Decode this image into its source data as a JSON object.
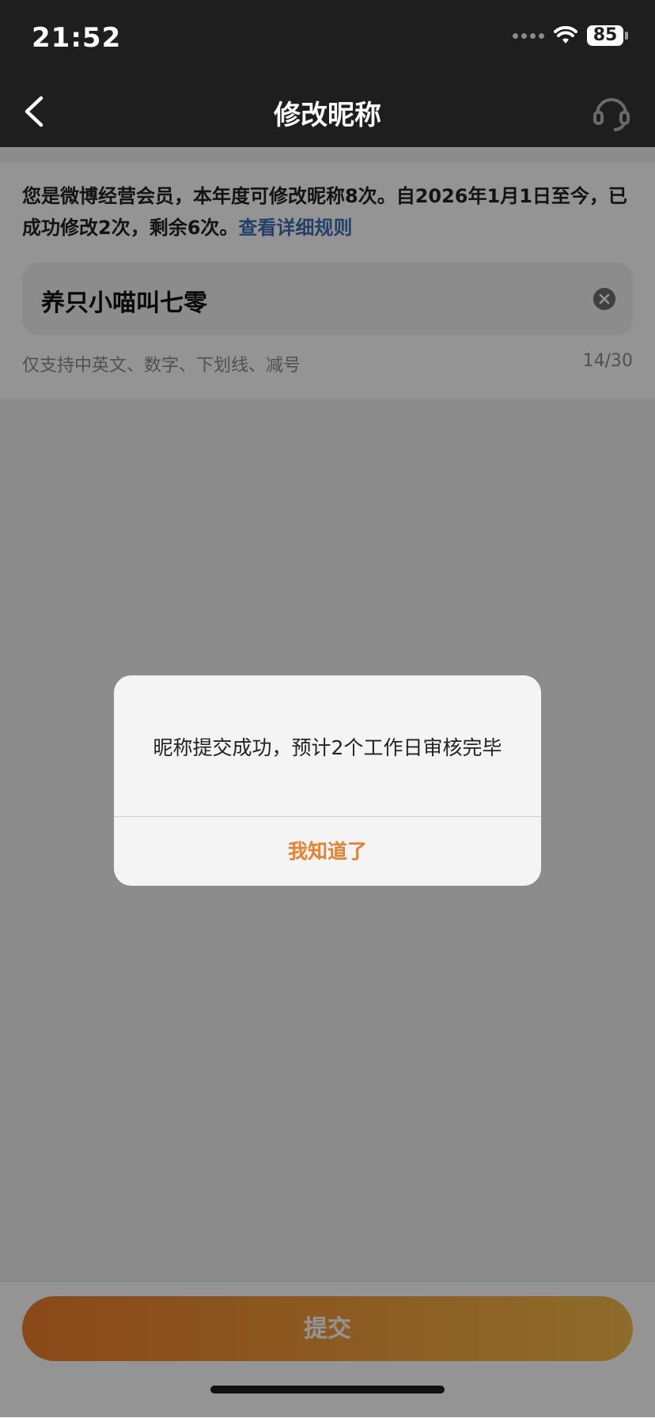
{
  "status_bar": {
    "time": "21:52",
    "battery": "85"
  },
  "nav": {
    "title": "修改昵称",
    "back_icon": "chevron-left-icon",
    "service_icon": "headset-icon"
  },
  "notice": {
    "text": "您是微博经营会员，本年度可修改昵称8次。自2026年1月1日至今，已成功修改2次，剩余6次。",
    "link": "查看详细规则"
  },
  "nickname_input": {
    "value": "养只小喵叫七零",
    "clear_icon": "clear-icon"
  },
  "hint": "仅支持中英文、数字、下划线、减号",
  "counter": "14/30",
  "submit_label": "提交",
  "dialog": {
    "message": "昵称提交成功，预计2个工作日审核完毕",
    "button": "我知道了"
  },
  "colors": {
    "accent": "#e8822f",
    "link": "#3d6fb0",
    "nav_bg": "#1e1e1e"
  }
}
